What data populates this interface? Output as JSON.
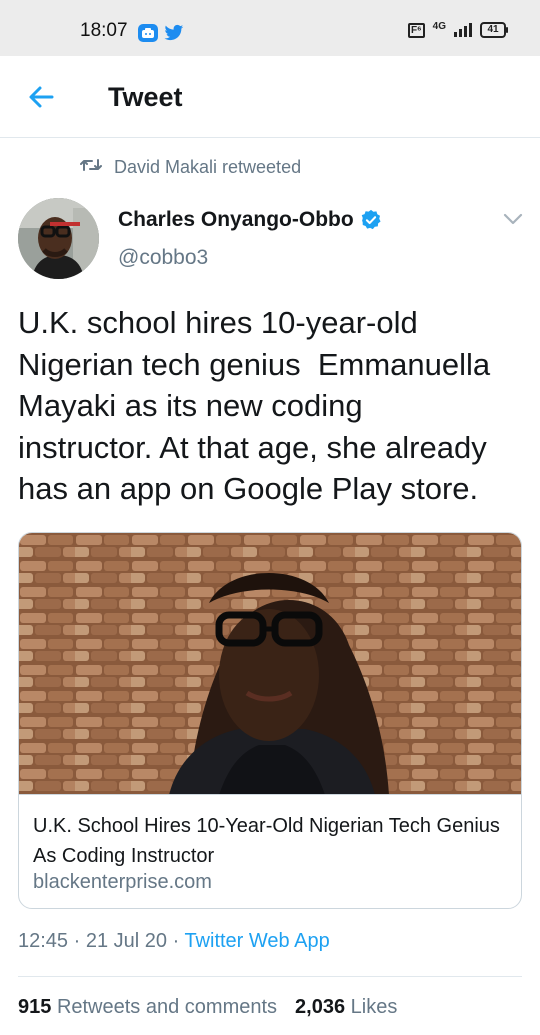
{
  "status_bar": {
    "time": "18:07",
    "network": "4G",
    "battery": "41",
    "icons": [
      "app-icon",
      "twitter-icon",
      "wifi-icon",
      "signal-icon",
      "battery-icon"
    ]
  },
  "header": {
    "title": "Tweet",
    "back_icon": "arrow-left-icon"
  },
  "retweet": {
    "label": "David Makali retweeted"
  },
  "author": {
    "name": "Charles Onyango-Obbo",
    "handle": "@cobbo3"
  },
  "tweet": {
    "text": "U.K. school hires 10-year-old\nNigerian tech genius  Emmanuella\nMayaki as its new coding\ninstructor. At that age, she already\nhas an app on Google Play store."
  },
  "card": {
    "title": "U.K. School Hires 10-Year-Old Nigerian Tech Genius As Coding Instructor",
    "domain": "blackenterprise.com"
  },
  "meta": {
    "time": "12:45",
    "date": "21 Jul 20",
    "source": "Twitter Web App",
    "separator": " · "
  },
  "stats": {
    "retweets_count": "915",
    "retweets_label": "Retweets and comments",
    "likes_count": "2,036",
    "likes_label": "Likes"
  },
  "colors": {
    "accent": "#1da1f2",
    "text": "#14171a",
    "muted": "#657786",
    "border": "#e1e8ed"
  }
}
